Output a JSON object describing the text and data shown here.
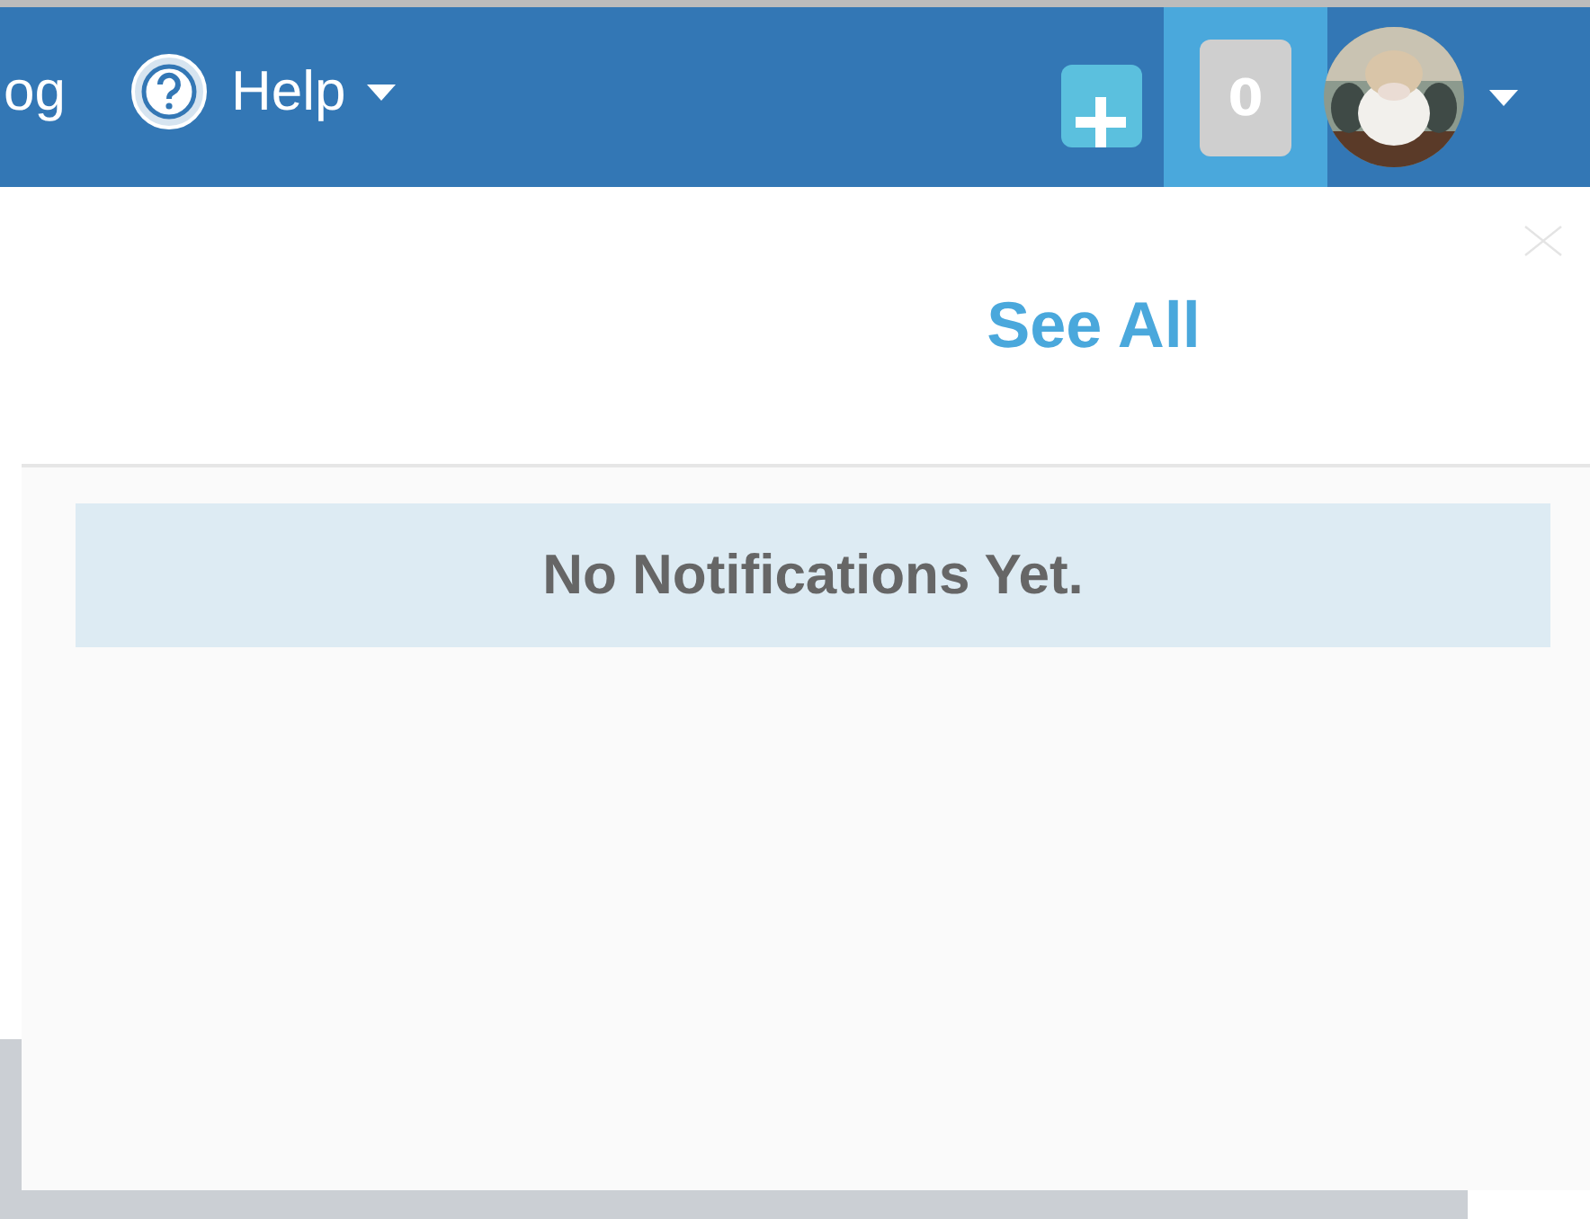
{
  "navbar": {
    "links": [
      {
        "label": "og",
        "kind": "link"
      },
      {
        "label": "Help",
        "kind": "menu"
      }
    ],
    "notifications": {
      "count": "0",
      "active": true
    }
  },
  "notifications_panel": {
    "see_all": "See All",
    "empty_message": "No Notifications Yet."
  }
}
